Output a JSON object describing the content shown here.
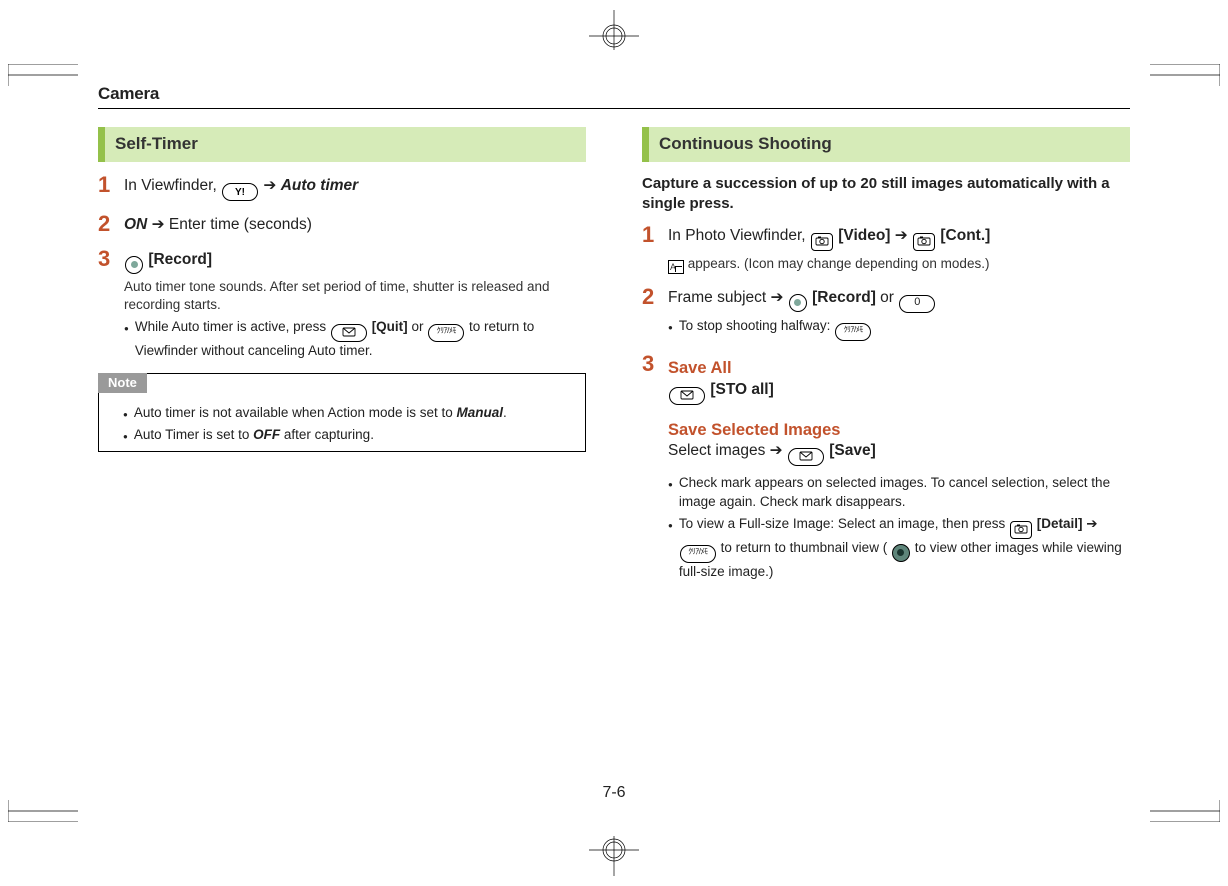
{
  "chapter": "Camera",
  "page_number": "7-6",
  "left": {
    "heading": "Self-Timer",
    "steps": {
      "s1": {
        "prefix": "In Viewfinder, ",
        "key": "Y!",
        "menu": "Auto timer"
      },
      "s2": {
        "on": "ON",
        "arrow": " ➔ ",
        "rest": "Enter time (seconds)"
      },
      "s3": {
        "action": "[Record]",
        "detail": "Auto timer tone sounds. After set period of time, shutter is released and recording starts.",
        "bullet1a": "While Auto timer is active, press ",
        "bullet1_action": "[Quit]",
        "bullet1b": " or ",
        "bullet1c": " to return to Viewfinder without canceling Auto timer."
      }
    },
    "note": {
      "label": "Note",
      "b1a": "Auto timer is not available when Action mode is set to ",
      "b1b": "Manual",
      "b1c": ".",
      "b2a": "Auto Timer is set to ",
      "b2b": "OFF",
      "b2c": " after capturing."
    }
  },
  "right": {
    "heading": "Continuous Shooting",
    "intro": "Capture a succession of up to 20 still images automatically with a single press.",
    "steps": {
      "s1": {
        "prefix": "In Photo Viewfinder, ",
        "video": "[Video]",
        "cont": "[Cont.]",
        "detail": " appears. (Icon may change depending on modes.)"
      },
      "s2": {
        "prefix": "Frame subject ➔ ",
        "record": "[Record]",
        "or": " or ",
        "key0": "0",
        "bullet": "To stop shooting halfway: "
      },
      "s3": {
        "save_all": "Save All",
        "sto_all": "[STO all]",
        "save_sel": "Save Selected Images",
        "sel_line_a": "Select images ➔ ",
        "sel_line_b": "[Save]",
        "b1": "Check mark appears on selected images. To cancel selection, select the image again. Check mark disappears.",
        "b2a": "To view a Full-size Image: Select an image, then press ",
        "b2_detail": "[Detail]",
        "b2b": " ➔ ",
        "b2c": " to return to thumbnail view (",
        "b2d": " to view other images while viewing full-size image.)"
      }
    }
  }
}
